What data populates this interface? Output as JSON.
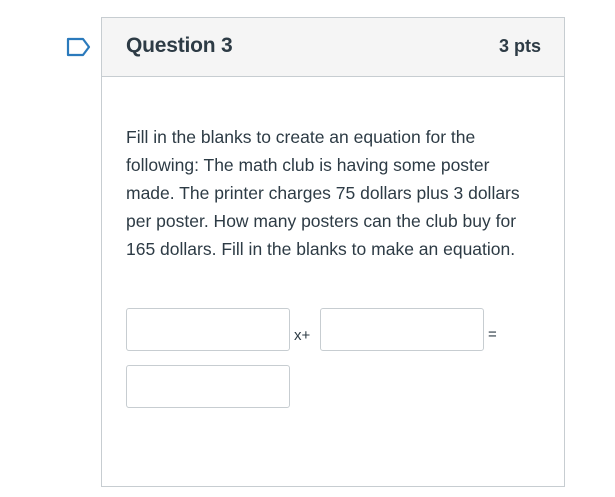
{
  "question": {
    "title": "Question 3",
    "points": "3 pts",
    "text": "Fill in the blanks to create an equation for the following:  The math club is having some poster made.  The printer charges 75 dollars plus 3 dollars per poster.  How many posters can the club buy for 165 dollars.  Fill in the blanks to make an equation."
  },
  "equation": {
    "blank_1_value": "",
    "operator_1": "x+",
    "blank_2_value": "",
    "operator_2": "=",
    "blank_3_value": ""
  },
  "colors": {
    "flag": "#2b7abc",
    "text": "#2d3b45",
    "border": "#c7cdd1",
    "header_bg": "#f5f5f5"
  }
}
